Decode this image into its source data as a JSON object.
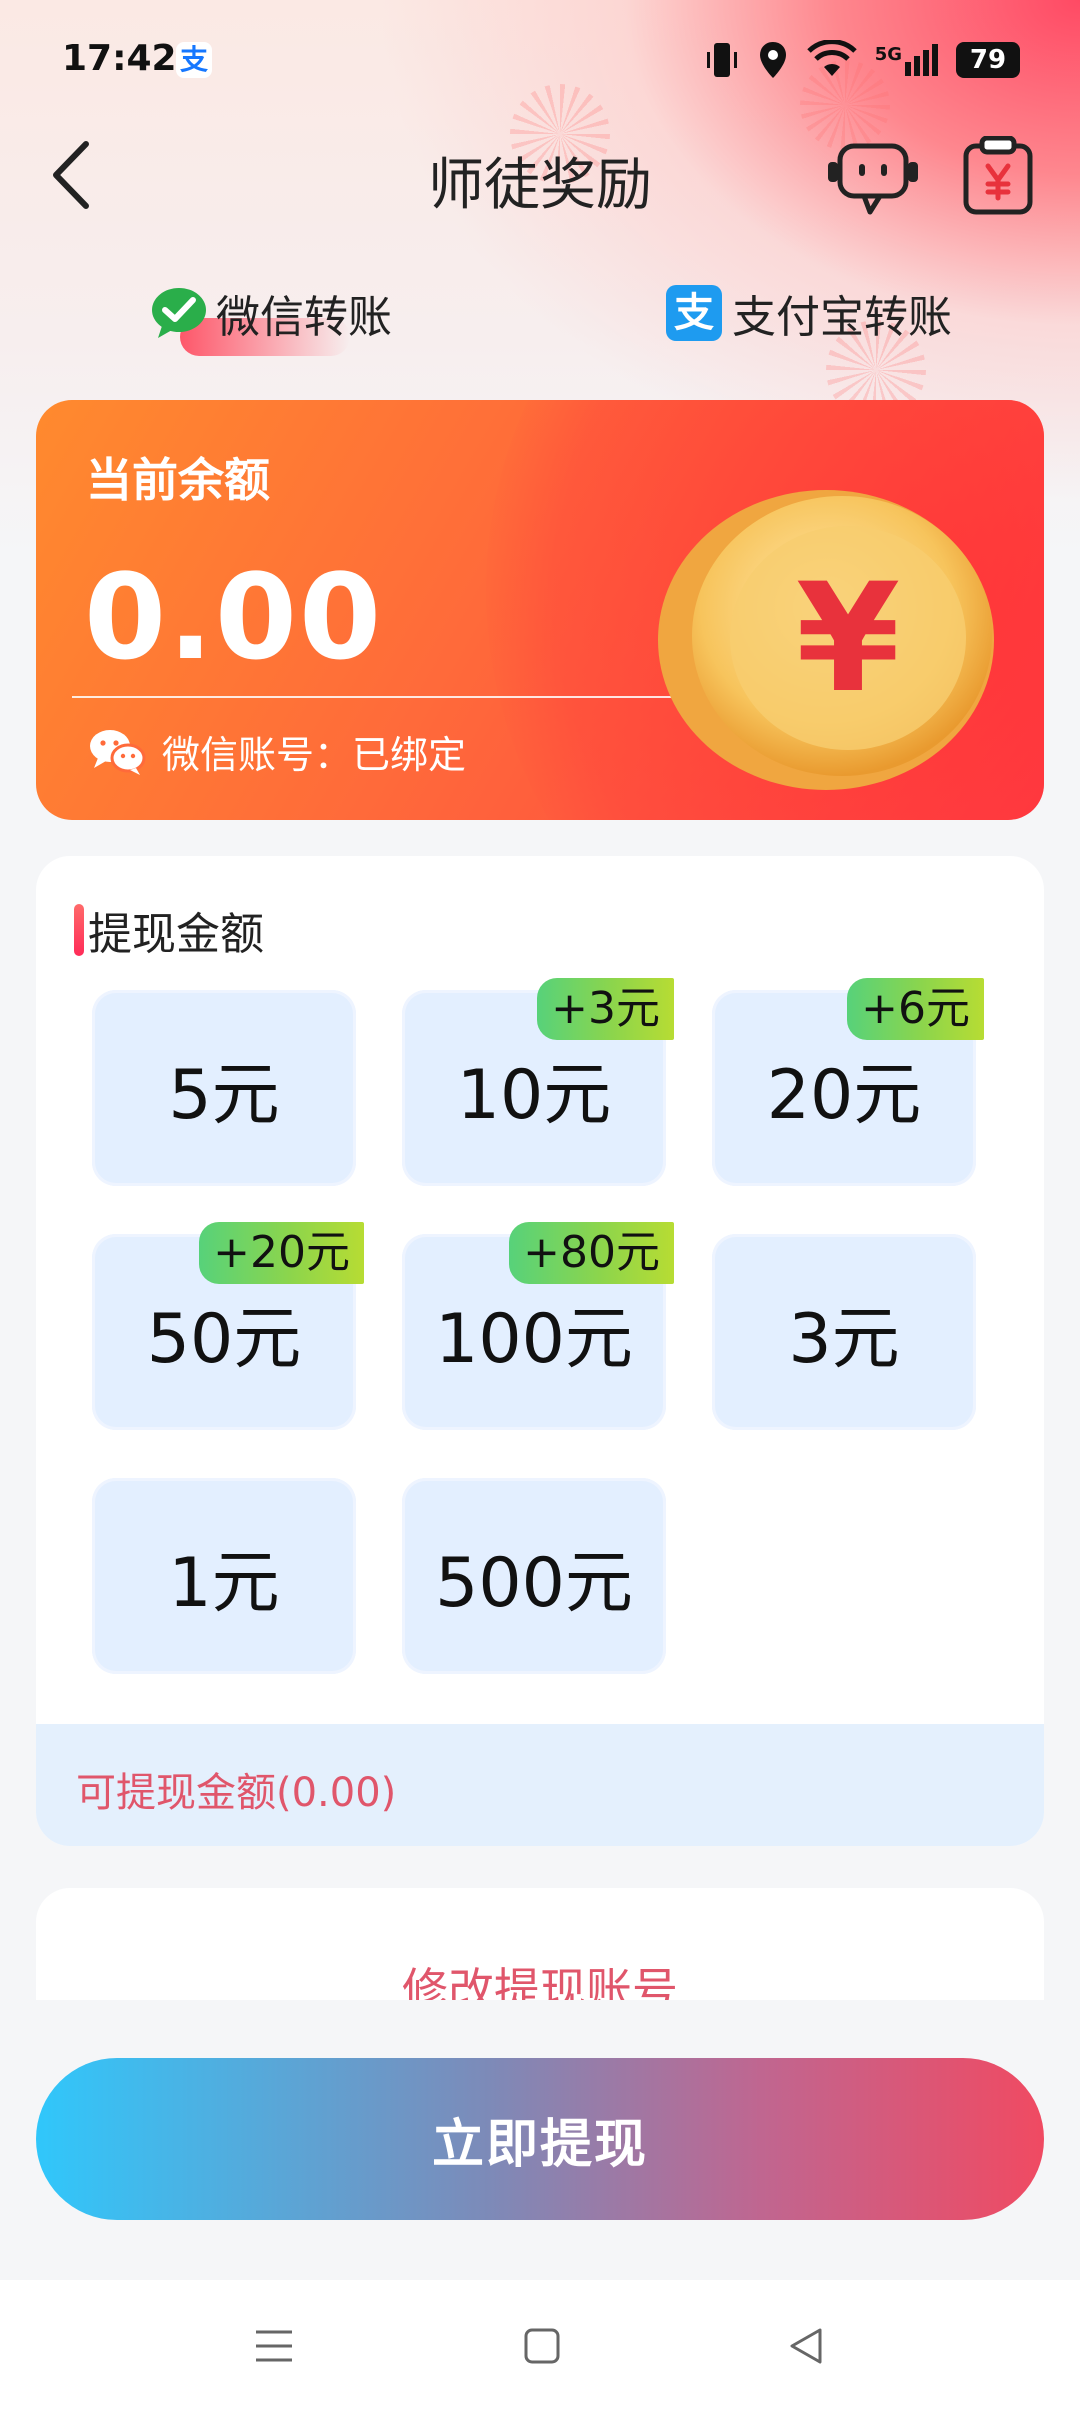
{
  "status_bar": {
    "time": "17:42",
    "battery": "79",
    "network": "5G",
    "alipay_badge": "支"
  },
  "header": {
    "title": "师徒奖励"
  },
  "pay_methods": {
    "wechat": "微信转账",
    "alipay": "支付宝转账",
    "alipay_icon_char": "支"
  },
  "balance": {
    "label": "当前余额",
    "value": "0.00",
    "binding": "微信账号：已绑定",
    "coin_symbol": "¥"
  },
  "withdraw": {
    "title": "提现金额",
    "options": [
      {
        "amount": "5元",
        "bonus": ""
      },
      {
        "amount": "10元",
        "bonus": "+3元"
      },
      {
        "amount": "20元",
        "bonus": "+6元"
      },
      {
        "amount": "50元",
        "bonus": "+20元"
      },
      {
        "amount": "100元",
        "bonus": "+80元"
      },
      {
        "amount": "3元",
        "bonus": ""
      },
      {
        "amount": "1元",
        "bonus": ""
      },
      {
        "amount": "500元",
        "bonus": ""
      }
    ],
    "available": "可提现金额(0.00)"
  },
  "modify_account": {
    "label": "修改提现账号"
  },
  "action": {
    "withdraw_now": "立即提现"
  },
  "colors": {
    "accent_red": "#e0566b",
    "option_bg": "#e3efff",
    "balance_orange": "#ff6a3a"
  }
}
